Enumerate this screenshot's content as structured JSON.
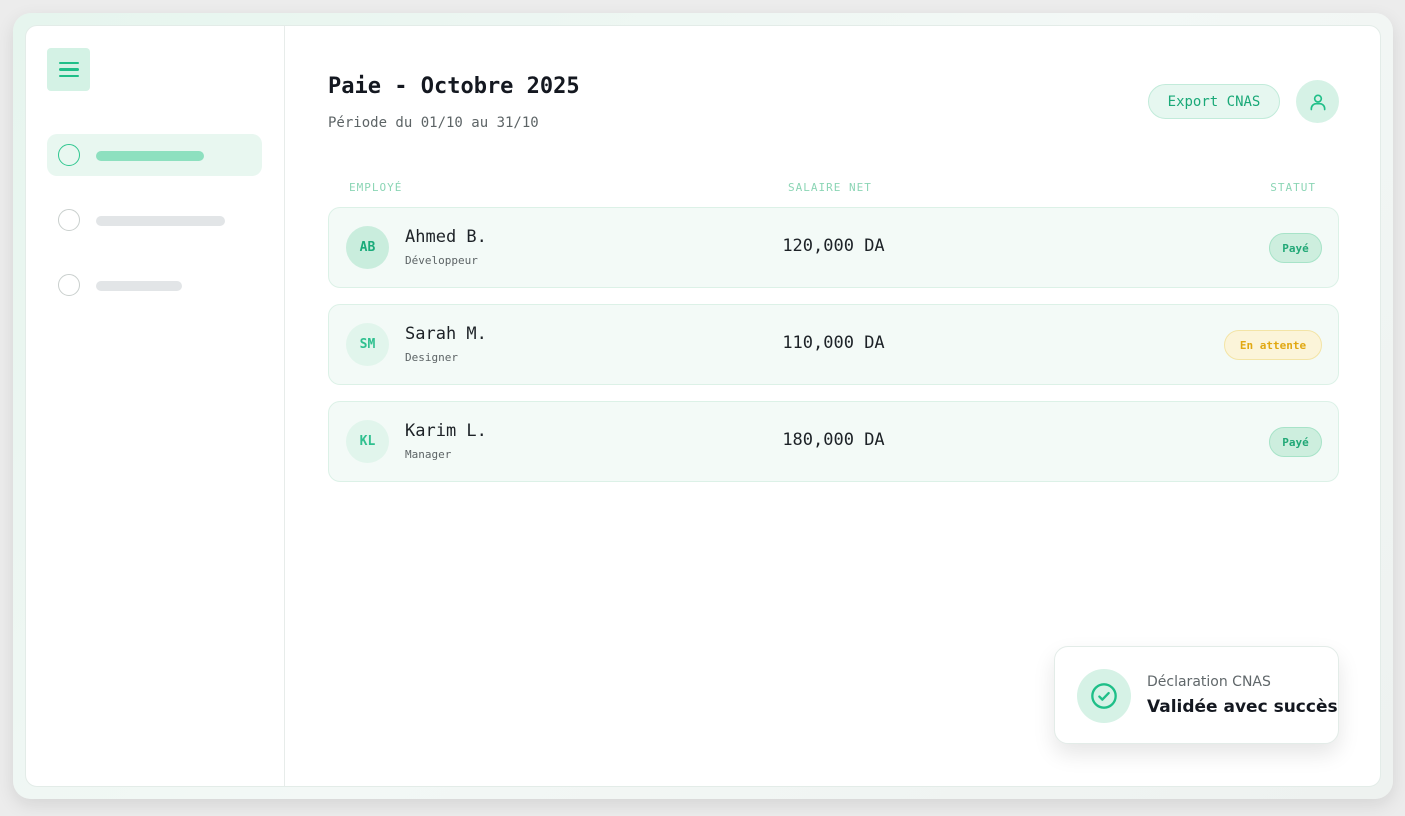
{
  "header": {
    "title": "Paie - Octobre 2025",
    "subtitle": "Période du 01/10 au 31/10",
    "export_label": "Export CNAS"
  },
  "table": {
    "columns": [
      "EMPLOYÉ",
      "SALAIRE NET",
      "STATUT"
    ],
    "rows": [
      {
        "initials": "AB",
        "name": "Ahmed B.",
        "role": "Développeur",
        "salary": "120,000 DA",
        "status": "Payé"
      },
      {
        "initials": "SM",
        "name": "Sarah M.",
        "role": "Designer",
        "salary": "110,000 DA",
        "status": "En attente"
      },
      {
        "initials": "KL",
        "name": "Karim L.",
        "role": "Manager",
        "salary": "180,000 DA",
        "status": "Payé"
      }
    ]
  },
  "toast": {
    "label": "Déclaration CNAS",
    "message": "Validée avec succès"
  },
  "icons": {
    "menu": "menu-icon",
    "user": "user-icon",
    "success": "check-circle-icon"
  },
  "colors": {
    "accent": "#1fbf88",
    "paid": "#22a877",
    "pending": "#e1a812"
  }
}
